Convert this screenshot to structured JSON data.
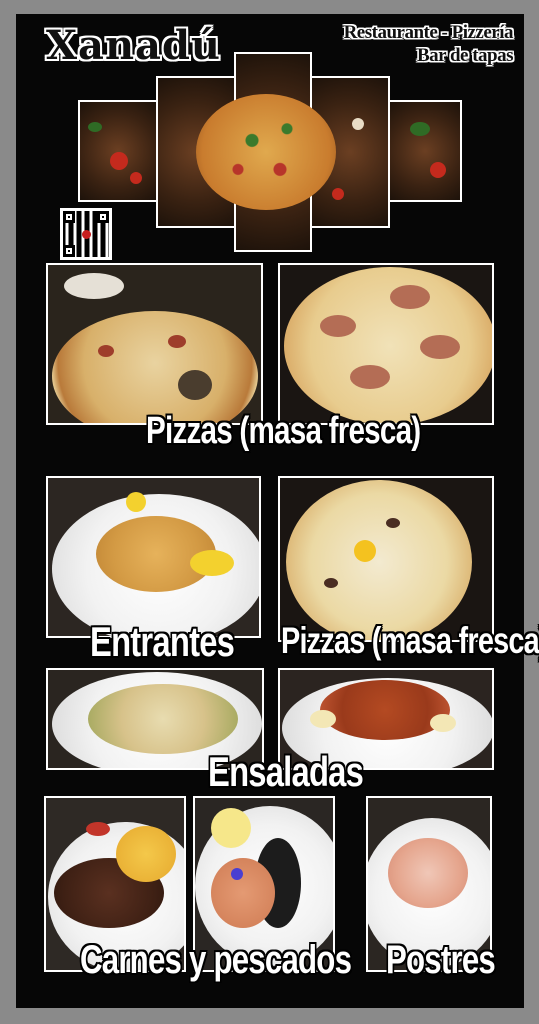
{
  "header": {
    "brand": "Xanadú",
    "subtitle_line1": "Restaurante - Pizzería",
    "subtitle_line2": "Bar de tapas"
  },
  "sections": [
    {
      "label": "Pizzas (masa fresca)"
    },
    {
      "label": "Entrantes"
    },
    {
      "label": "Pizzas (masa fresca)"
    },
    {
      "label": "Ensaladas"
    },
    {
      "label": "Carnes y pescados"
    },
    {
      "label": "Postres"
    }
  ],
  "colors": {
    "background": "#8a8a8a",
    "panel": "#060606",
    "text": "#ffffff"
  }
}
